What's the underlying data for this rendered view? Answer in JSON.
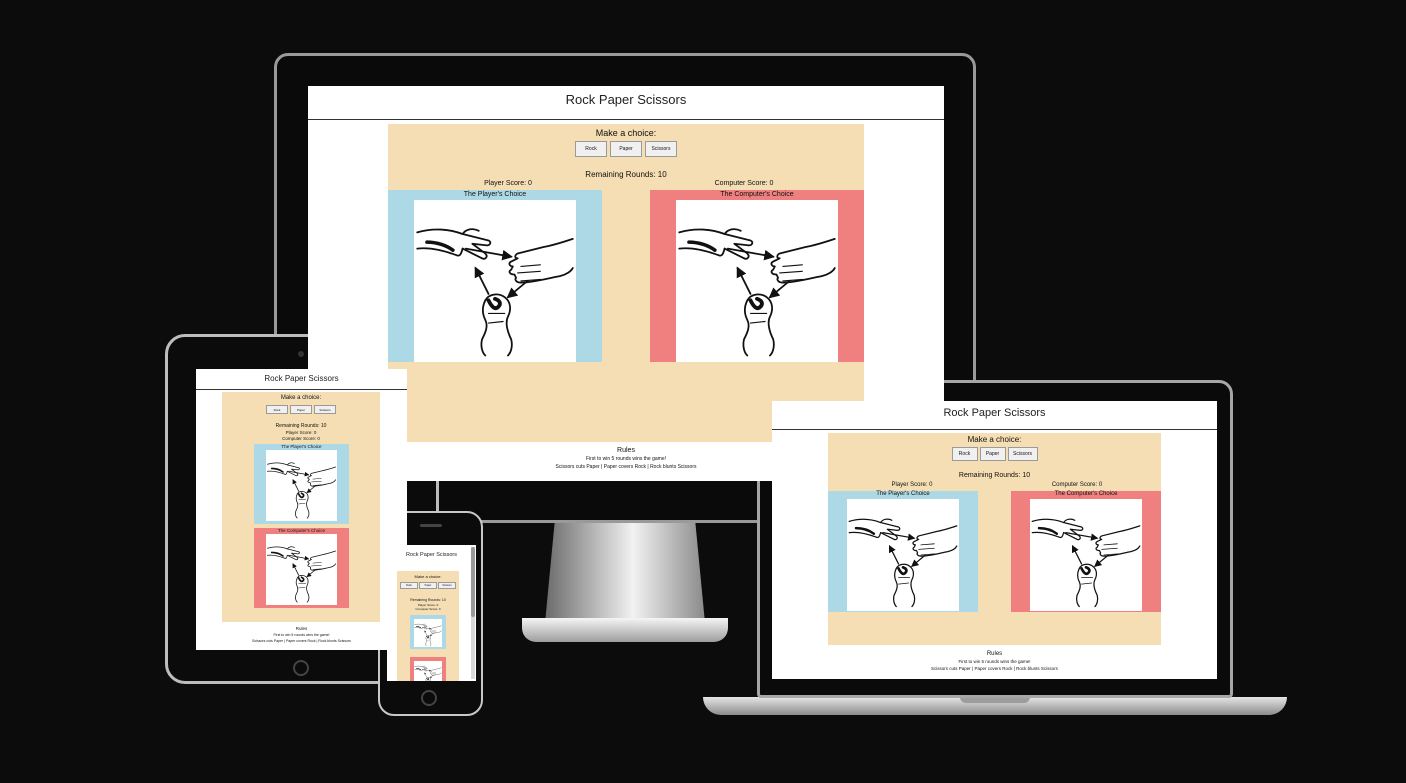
{
  "app": {
    "title": "Rock Paper Scissors",
    "prompt": "Make a choice:",
    "buttons": {
      "rock": "Rock",
      "paper": "Paper",
      "scissors": "Scissors"
    },
    "remaining_rounds": "Remaining Rounds: 10",
    "player_score": "Player Score: 0",
    "computer_score": "Computer Score: 0",
    "player_choice_title": "The Player's Choice",
    "computer_choice_title": "The Computer's Choice",
    "rules_title": "Rules",
    "rules_line1": "First to win 5 rounds wins the game!",
    "rules_line2": "Scissors cuts Paper | Paper covers Rock | Rock blunts Scissors"
  },
  "icons": {
    "choice_image": "rock-paper-scissors-hands-icon"
  },
  "colors": {
    "background": "#0d0c0c",
    "panel": "#f5deb3",
    "player_box": "#add8e6",
    "computer_box": "#f08080"
  }
}
